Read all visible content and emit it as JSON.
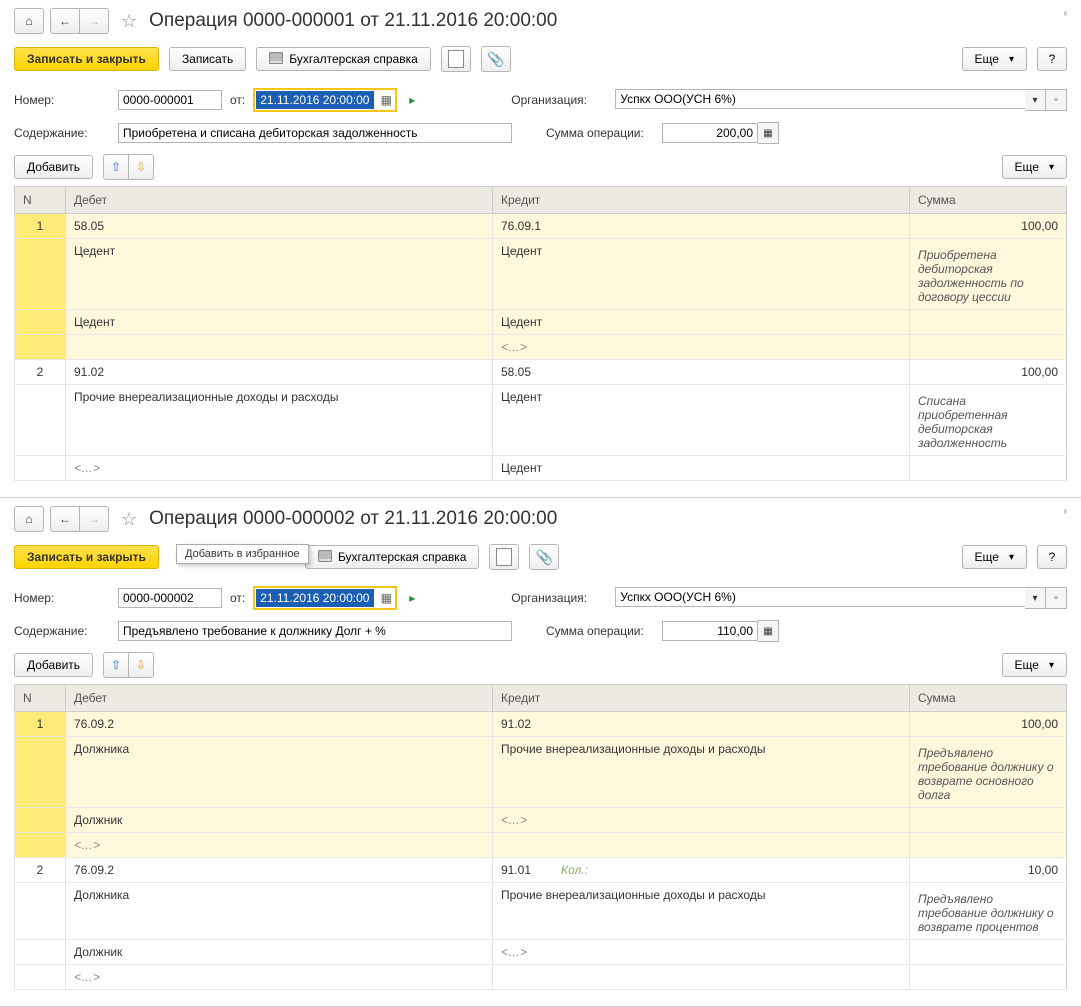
{
  "p1": {
    "title": "Операция 0000-000001 от 21.11.2016 20:00:00",
    "save_close": "Записать и закрыть",
    "save": "Записать",
    "report": "Бухгалтерская справка",
    "more": "Еще",
    "help": "?",
    "num_label": "Номер:",
    "num_value": "0000-000001",
    "from_label": "от:",
    "date_value": "21.11.2016 20:00:00",
    "org_label": "Организация:",
    "org_value": "Успкх ООО(УСН 6%)",
    "content_label": "Содержание:",
    "content_value": "Приобретена и списана дебиторская задолженность",
    "sum_label": "Сумма операции:",
    "sum_value": "200,00",
    "add": "Добавить",
    "cols": {
      "n": "N",
      "debit": "Дебет",
      "credit": "Кредит",
      "sum": "Сумма"
    },
    "rows": [
      {
        "n": "1",
        "hl": true,
        "debit": [
          "58.05",
          "Цедент",
          "Цедент"
        ],
        "credit": [
          "76.09.1",
          "Цедент",
          "Цедент",
          "<…>"
        ],
        "amount": "100,00",
        "note": "Приобретена дебиторская задолженность по договору цессии"
      },
      {
        "n": "2",
        "hl": false,
        "debit": [
          "91.02",
          "Прочие внереализационные доходы и расходы",
          "<…>"
        ],
        "credit": [
          "58.05",
          "Цедент",
          "Цедент"
        ],
        "amount": "100,00",
        "note": "Списана приобретенная дебиторская задолженность"
      }
    ]
  },
  "p2": {
    "title": "Операция 0000-000002 от 21.11.2016 20:00:00",
    "save_close": "Записать и закрыть",
    "save": "Записать",
    "tooltip": "Добавить в избранное",
    "report": "Бухгалтерская справка",
    "more": "Еще",
    "help": "?",
    "num_label": "Номер:",
    "num_value": "0000-000002",
    "from_label": "от:",
    "date_value": "21.11.2016 20:00:00",
    "org_label": "Организация:",
    "org_value": "Успкх ООО(УСН 6%)",
    "content_label": "Содержание:",
    "content_value": "Предъявлено требование к должнику Долг + %",
    "sum_label": "Сумма операции:",
    "sum_value": "110,00",
    "add": "Добавить",
    "cols": {
      "n": "N",
      "debit": "Дебет",
      "credit": "Кредит",
      "sum": "Сумма"
    },
    "rows": [
      {
        "n": "1",
        "hl": true,
        "debit": [
          "76.09.2",
          "Должника",
          "Должник",
          "<…>"
        ],
        "credit": [
          "91.02",
          "Прочие внереализационные доходы и расходы",
          "<…>"
        ],
        "amount": "100,00",
        "note": "Предъявлено требование должнику о возврате основного долга"
      },
      {
        "n": "2",
        "hl": false,
        "debit": [
          "76.09.2",
          "Должника",
          "Должник",
          "<…>"
        ],
        "credit": [
          "91.01",
          "Прочие внереализационные доходы и расходы",
          "<…>"
        ],
        "credit_extra": "Кол.:",
        "amount": "10,00",
        "note": "Предъявлено требование должнику о возврате процентов"
      }
    ]
  }
}
